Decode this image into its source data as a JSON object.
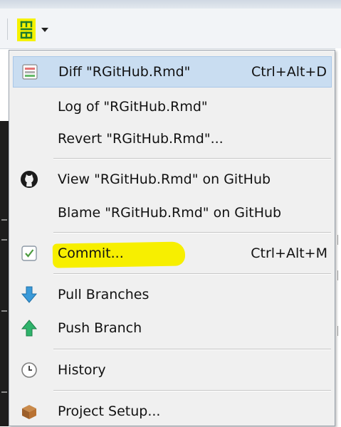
{
  "toolbar": {
    "git_button": {
      "icon": "git-icon",
      "accent": "#f5f200",
      "has_dropdown": true
    }
  },
  "menu": {
    "items": [
      {
        "label": "Diff \"RGitHub.Rmd\"",
        "shortcut": "Ctrl+Alt+D",
        "icon": "diff-icon",
        "highlighted": true
      },
      {
        "label": "Log of \"RGitHub.Rmd\"",
        "shortcut": "",
        "icon": ""
      },
      {
        "label": "Revert \"RGitHub.Rmd\"...",
        "shortcut": "",
        "icon": ""
      },
      {
        "label": "View \"RGitHub.Rmd\" on GitHub",
        "shortcut": "",
        "icon": "github-icon"
      },
      {
        "label": "Blame \"RGitHub.Rmd\" on GitHub",
        "shortcut": "",
        "icon": ""
      },
      {
        "label": "Commit...",
        "shortcut": "Ctrl+Alt+M",
        "icon": "commit-checkbox-icon",
        "highlighter": "#f7ef00"
      },
      {
        "label": "Pull Branches",
        "shortcut": "",
        "icon": "pull-arrow-icon"
      },
      {
        "label": "Push Branch",
        "shortcut": "",
        "icon": "push-arrow-icon"
      },
      {
        "label": "History",
        "shortcut": "",
        "icon": "clock-icon"
      },
      {
        "label": "Project Setup...",
        "shortcut": "",
        "icon": "box-icon"
      }
    ]
  },
  "colors": {
    "hover_bg": "#c9ddf1",
    "menu_bg": "#f0f0f0",
    "pull_arrow": "#3a9ad9",
    "push_arrow": "#2fb36b"
  }
}
